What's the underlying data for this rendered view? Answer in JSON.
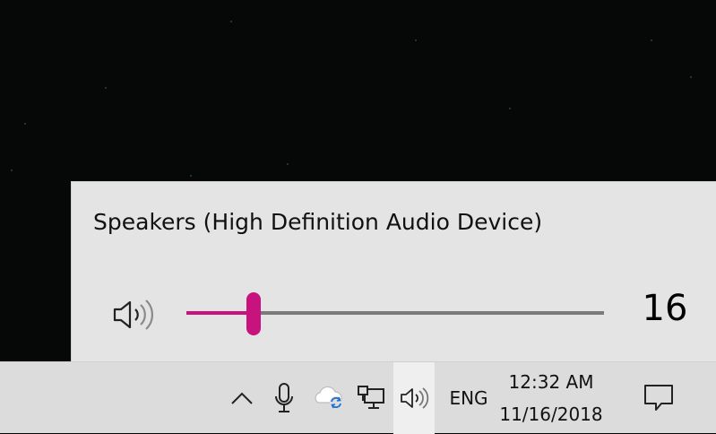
{
  "volume_flyout": {
    "device_name": "Speakers (High Definition Audio Device)",
    "volume_value": "16",
    "volume_level_percent": 16,
    "speaker_icon": "speaker-icon",
    "accent_color": "#c8137f"
  },
  "taskbar": {
    "tray_icons": [
      "chevron-up-icon",
      "microphone-icon",
      "onedrive-sync-icon",
      "network-icon",
      "speaker-icon"
    ],
    "language": "ENG",
    "time": "12:32 AM",
    "date": "11/16/2018",
    "notifications_icon": "action-center-icon"
  }
}
